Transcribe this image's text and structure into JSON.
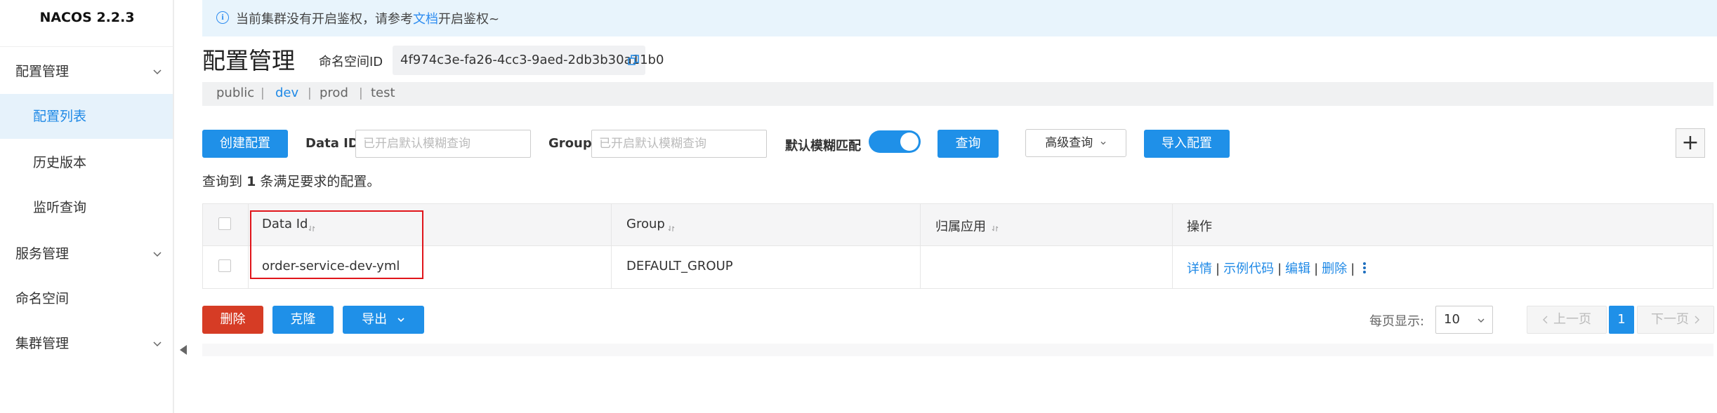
{
  "app": {
    "brand": "NACOS 2.2.3"
  },
  "sidebar": {
    "items": [
      {
        "label": "配置管理",
        "expandable": true
      },
      {
        "label": "配置列表",
        "active": true
      },
      {
        "label": "历史版本"
      },
      {
        "label": "监听查询"
      },
      {
        "label": "服务管理",
        "expandable": true
      },
      {
        "label": "命名空间"
      },
      {
        "label": "集群管理",
        "expandable": true
      }
    ]
  },
  "notice": {
    "text_before": "当前集群没有开启鉴权，请参考",
    "link": "文档",
    "text_after": "开启鉴权~"
  },
  "header": {
    "title": "配置管理",
    "namespace_label": "命名空间ID",
    "namespace_id": "4f974c3e-fa26-4cc3-9aed-2db3b30a11b0"
  },
  "namespaces": {
    "tabs": [
      "public",
      "dev",
      "prod",
      "test"
    ],
    "separator": "|",
    "active": "dev"
  },
  "toolbar": {
    "create_label": "创建配置",
    "dataid_label": "Data ID",
    "dataid_placeholder": "已开启默认模糊查询",
    "group_label": "Group",
    "group_placeholder": "已开启默认模糊查询",
    "fuzzy_label": "默认模糊匹配",
    "fuzzy_on": true,
    "query_label": "查询",
    "advanced_label": "高级查询",
    "import_label": "导入配置",
    "add_label": "+"
  },
  "result": {
    "prefix": "查询到",
    "count": "1",
    "suffix": "条满足要求的配置。"
  },
  "table": {
    "headers": [
      "Data Id",
      "Group",
      "归属应用",
      "操作"
    ],
    "rows": [
      {
        "data_id": "order-service-dev-yml",
        "group": "DEFAULT_GROUP",
        "app": ""
      }
    ],
    "ops": [
      "详情",
      "示例代码",
      "编辑",
      "删除"
    ],
    "op_sep": "|"
  },
  "bottom": {
    "delete_label": "删除",
    "clone_label": "克隆",
    "export_label": "导出",
    "page_size_label": "每页显示:",
    "page_size": "10",
    "prev_label": "上一页",
    "current_page": "1",
    "next_label": "下一页"
  },
  "colors": {
    "primary": "#1f90e8",
    "danger": "#d63c25",
    "highlight": "#e0151b",
    "notice_bg": "#e8f4fc"
  }
}
